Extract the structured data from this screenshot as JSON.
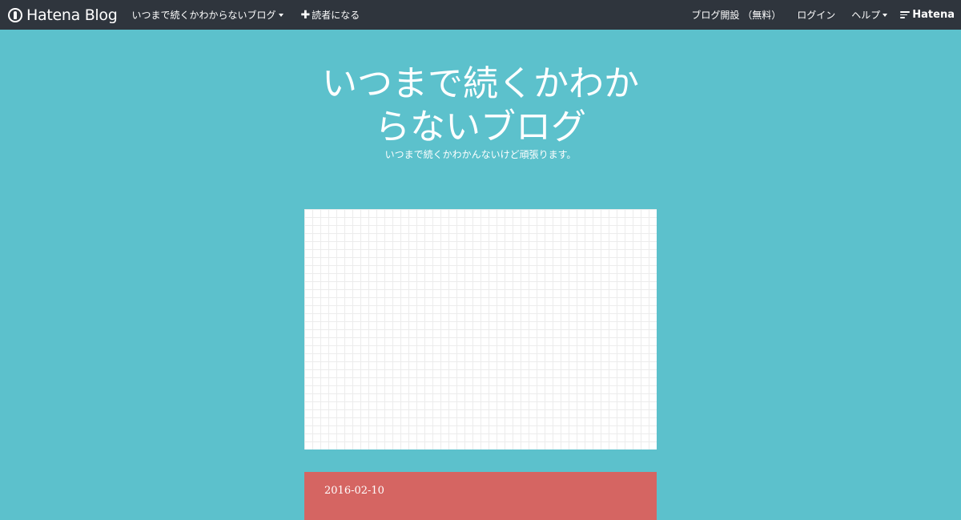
{
  "navbar": {
    "logo_text": "Hatena Blog",
    "blog_menu_label": "いつまで続くかわからないブログ",
    "subscribe_label": "読者になる",
    "open_blog_label": "ブログ開設 （無料）",
    "login_label": "ログイン",
    "help_label": "ヘルプ",
    "brand_text": "Hatena"
  },
  "blog": {
    "title": "いつまで続くかわからないブログ",
    "description": "いつまで続くかわかんないけど頑張ります。"
  },
  "entry": {
    "date": "2016-02-10"
  },
  "colors": {
    "background": "#5cc1cc",
    "navbar": "#2f353d",
    "entry": "#d56562"
  }
}
